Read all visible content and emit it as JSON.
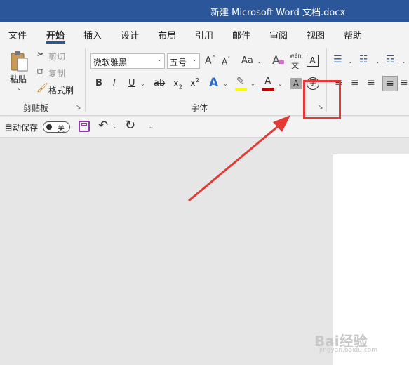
{
  "window": {
    "title": "新建 Microsoft Word 文档.docx",
    "title_chevron": "⌄"
  },
  "tabs": [
    {
      "label": "文件"
    },
    {
      "label": "开始"
    },
    {
      "label": "插入"
    },
    {
      "label": "设计"
    },
    {
      "label": "布局"
    },
    {
      "label": "引用"
    },
    {
      "label": "邮件"
    },
    {
      "label": "审阅"
    },
    {
      "label": "视图"
    },
    {
      "label": "帮助"
    }
  ],
  "active_tab": "开始",
  "clipboard": {
    "paste_label": "粘贴",
    "cut_label": "剪切",
    "copy_label": "复制",
    "format_painter_label": "格式刷",
    "group_label": "剪贴板"
  },
  "font": {
    "font_name": "微软雅黑",
    "font_size": "五号",
    "group_label": "字体",
    "grow_glyph": "A",
    "shrink_glyph": "A",
    "case_glyph": "Aa",
    "phonetic_top": "wén",
    "phonetic_bottom": "文",
    "border_glyph": "A",
    "bold": "B",
    "italic": "I",
    "underline": "U",
    "strike": "ab",
    "subscript_base": "x",
    "subscript_sub": "2",
    "superscript_base": "x",
    "superscript_sup": "2",
    "effects_glyph": "A",
    "font_color_glyph": "A",
    "shade_glyph": "A",
    "enclose_glyph": "字",
    "dialog_launcher": "↘"
  },
  "qat": {
    "autosave_label": "自动保存",
    "autosave_state": "关"
  },
  "watermark": {
    "main": "Bai经验",
    "sub": "jingyan.baidu.com"
  },
  "colors": {
    "brand": "#2b579a",
    "highlight": "#2b579a",
    "font_color_bar": "#c00000",
    "highlight_bar": "#ffff00",
    "annotation": "#e53935"
  }
}
